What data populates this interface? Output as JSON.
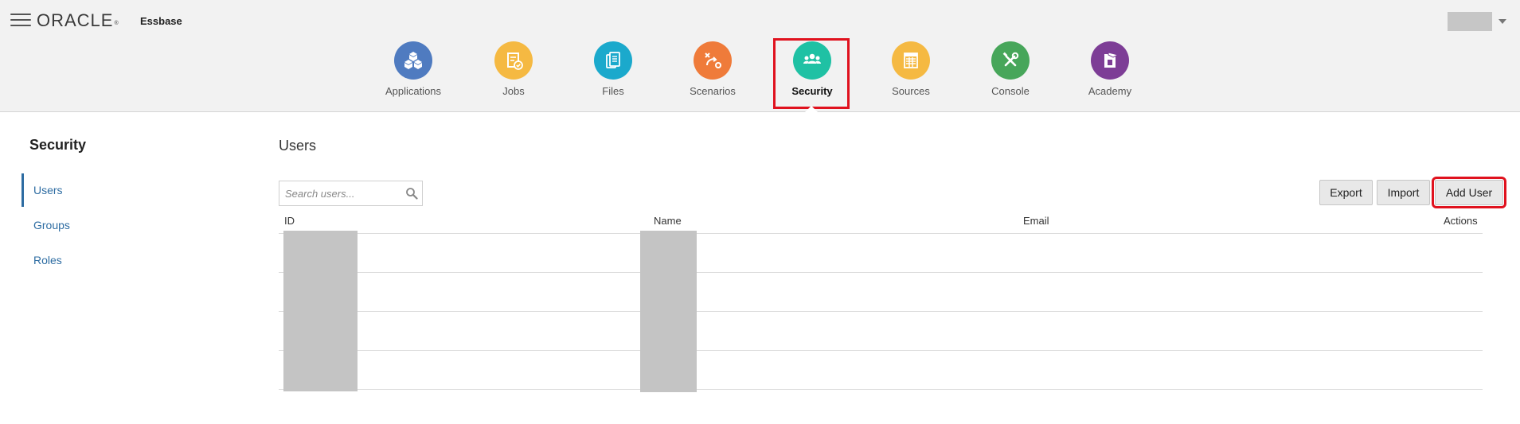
{
  "header": {
    "logo_text": "ORACLE",
    "logo_tm": "®",
    "product_name": "Essbase"
  },
  "nav": {
    "items": [
      {
        "label": "Applications",
        "icon": "applications-icon",
        "color": "#4f7bc0"
      },
      {
        "label": "Jobs",
        "icon": "jobs-icon",
        "color": "#f5b942"
      },
      {
        "label": "Files",
        "icon": "files-icon",
        "color": "#1ba9cc"
      },
      {
        "label": "Scenarios",
        "icon": "scenarios-icon",
        "color": "#ef7b3a"
      },
      {
        "label": "Security",
        "icon": "security-icon",
        "color": "#1fc1a4",
        "active": true
      },
      {
        "label": "Sources",
        "icon": "sources-icon",
        "color": "#f5b942"
      },
      {
        "label": "Console",
        "icon": "console-icon",
        "color": "#47a65a"
      },
      {
        "label": "Academy",
        "icon": "academy-icon",
        "color": "#7d3d96"
      }
    ]
  },
  "sidebar": {
    "title": "Security",
    "items": [
      {
        "label": "Users",
        "active": true
      },
      {
        "label": "Groups"
      },
      {
        "label": "Roles"
      }
    ]
  },
  "main": {
    "title": "Users",
    "search_placeholder": "Search users...",
    "buttons": {
      "export": "Export",
      "import": "Import",
      "add_user": "Add User"
    },
    "table": {
      "columns": [
        "ID",
        "Name",
        "Email",
        "Actions"
      ],
      "row_count": 4
    }
  },
  "colors": {
    "accent_link": "#2d6ca2",
    "highlight_red": "#e0121e"
  }
}
